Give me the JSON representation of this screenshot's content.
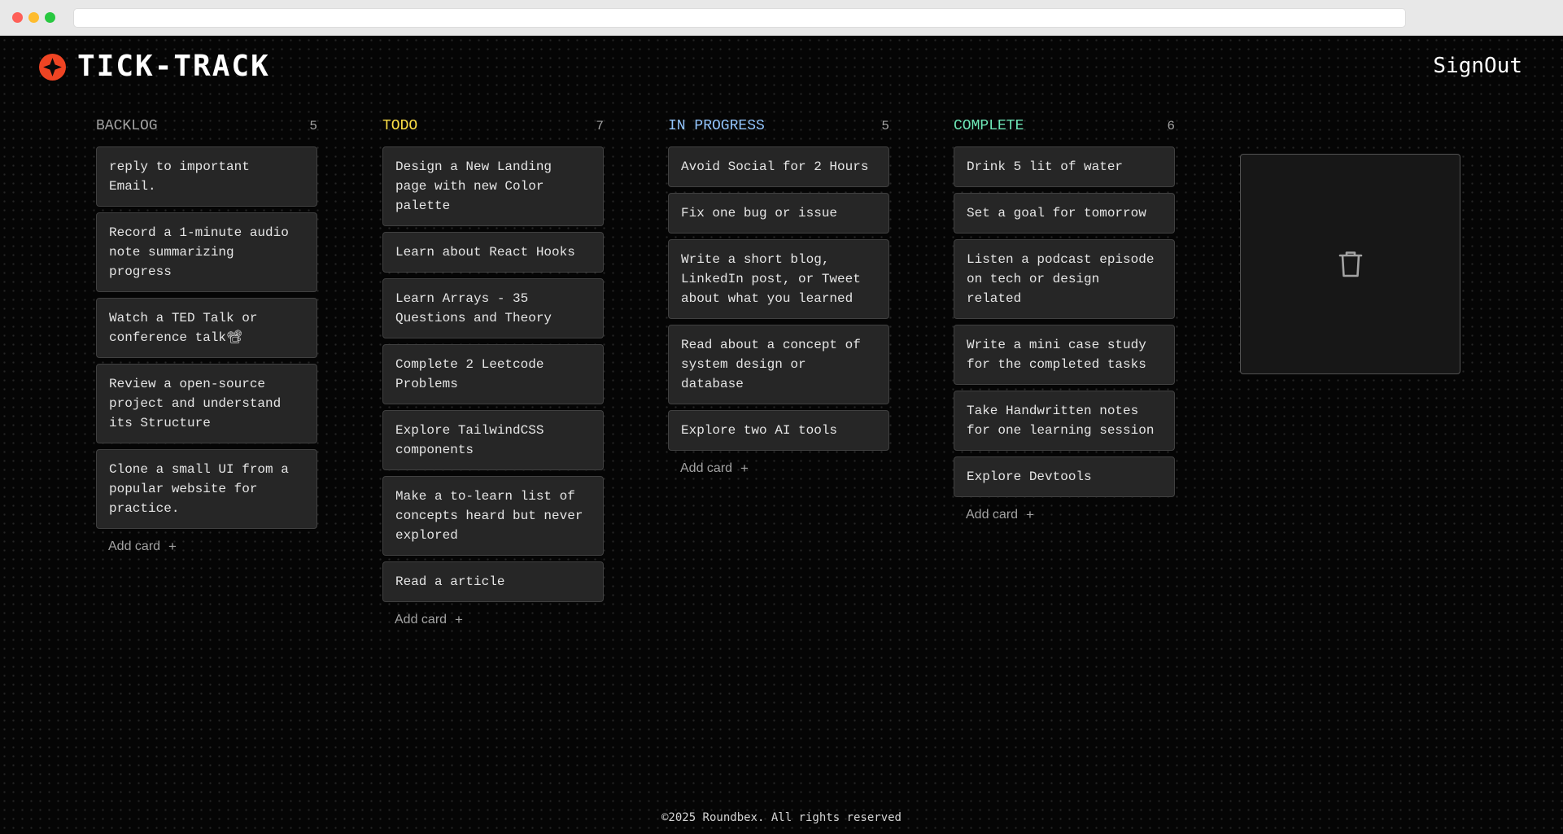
{
  "app": {
    "title": "TICK-TRACK",
    "signout_label": "SignOut",
    "footer": "©2025 Roundbex. All rights reserved"
  },
  "colors": {
    "backlog": "#a3a3a3",
    "todo": "#fde047",
    "in_progress": "#93c5fd",
    "complete": "#6ee7b7",
    "logo_accent": "#ef4423"
  },
  "icons": {
    "logo": "logo-icon",
    "trash": "trash-icon",
    "add": "plus-icon"
  },
  "add_card_label": "Add card",
  "add_card_icon": "+",
  "columns": [
    {
      "title": "BACKLOG",
      "count": "5",
      "color": "#a3a3a3",
      "cards": [
        "reply to important Email.",
        "Record a 1-minute audio note summarizing progress",
        "Watch a TED Talk or conference talk📽",
        "Review a open-source project and understand its Structure",
        "Clone a small UI from a popular website for practice."
      ]
    },
    {
      "title": "TODO",
      "count": "7",
      "color": "#fde047",
      "cards": [
        "Design a New Landing page with new Color palette",
        "Learn about React Hooks",
        "Learn Arrays - 35 Questions and Theory",
        "Complete 2 Leetcode Problems",
        "Explore TailwindCSS components",
        "Make a to-learn list of concepts heard but never explored",
        "Read a article"
      ]
    },
    {
      "title": "IN PROGRESS",
      "count": "5",
      "color": "#93c5fd",
      "cards": [
        "Avoid Social for 2 Hours",
        "Fix one bug or issue",
        "Write a short blog, LinkedIn post, or Tweet about what you learned",
        "Read about a concept of system design or database",
        "Explore two AI tools"
      ]
    },
    {
      "title": "COMPLETE",
      "count": "6",
      "color": "#6ee7b7",
      "cards": [
        "Drink 5 lit of water",
        "Set a goal for tomorrow",
        "Listen a podcast episode on tech or design related",
        "Write a mini case study for the completed tasks",
        "Take Handwritten notes for one learning session",
        "Explore Devtools"
      ]
    }
  ]
}
